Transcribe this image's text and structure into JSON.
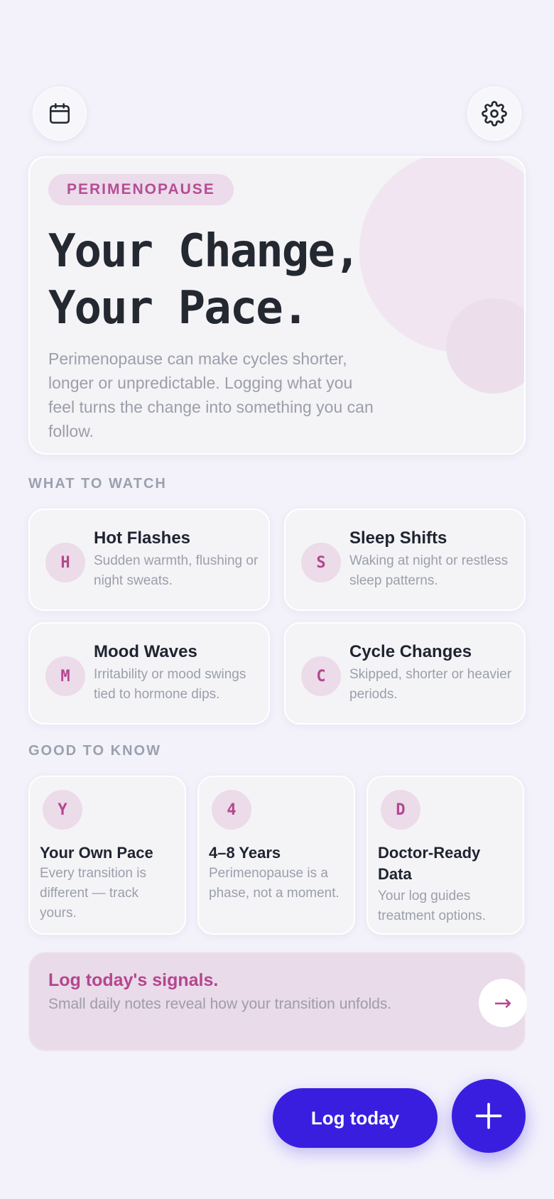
{
  "header": {
    "calendar_icon": "calendar-icon",
    "settings_icon": "gear-icon"
  },
  "hero": {
    "badge": "PERIMENOPAUSE",
    "title_line1": "Your Change,",
    "title_line2": "Your Pace.",
    "body": "Perimenopause can make cycles shorter, longer or unpredictable. Logging what you feel turns the change into something you can follow."
  },
  "watch": {
    "label": "WHAT TO WATCH",
    "items": [
      {
        "letter": "H",
        "title": "Hot Flashes",
        "desc": "Sudden warmth, flushing or night sweats."
      },
      {
        "letter": "S",
        "title": "Sleep Shifts",
        "desc": "Waking at night or restless sleep patterns."
      },
      {
        "letter": "M",
        "title": "Mood Waves",
        "desc": "Irritability or mood swings tied to hormone dips."
      },
      {
        "letter": "C",
        "title": "Cycle Changes",
        "desc": "Skipped, shorter or heavier periods."
      }
    ]
  },
  "know": {
    "label": "GOOD TO KNOW",
    "items": [
      {
        "letter": "Y",
        "title": "Your Own Pace",
        "desc": "Every transition is different — track yours."
      },
      {
        "letter": "4",
        "title": "4–8 Years",
        "desc": "Perimenopause is a phase, not a moment."
      },
      {
        "letter": "D",
        "title": "Doctor-Ready Data",
        "desc": "Your log guides treatment options."
      }
    ]
  },
  "cta": {
    "title": "Log today's signals.",
    "subtitle": "Small daily notes reveal how your transition unfolds.",
    "arrow": "→"
  },
  "actions": {
    "log_today": "Log today",
    "add_icon": "plus-icon"
  },
  "colors": {
    "background": "#f3f2fb",
    "accent": "#b4468f",
    "primary": "#3a1ee0"
  }
}
